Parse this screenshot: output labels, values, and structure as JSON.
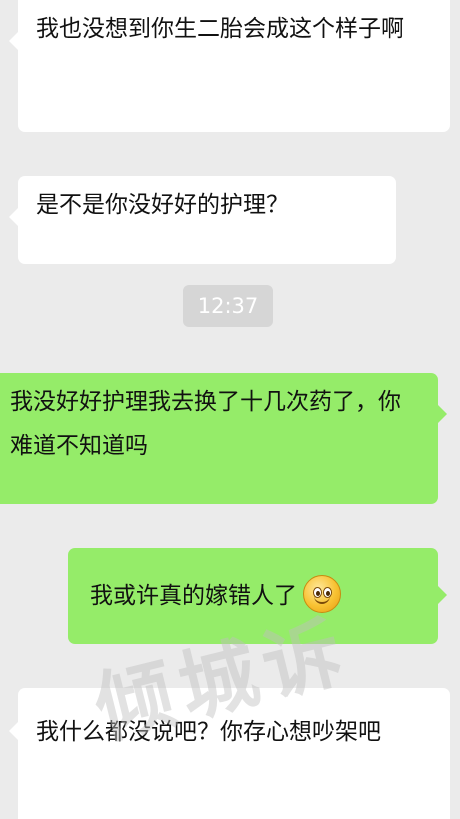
{
  "chat": {
    "timestamp": "12:37",
    "messages": [
      {
        "sender": "other",
        "text": "我也没想到你生二胎会成这个样子啊"
      },
      {
        "sender": "other",
        "text": "是不是你没好好的护理？"
      },
      {
        "sender": "self",
        "text": "我没好好护理我去换了十几次药了，你难道不知道吗"
      },
      {
        "sender": "self",
        "text": "我或许真的嫁错人了",
        "emoji": "smile-emoji-icon"
      },
      {
        "sender": "other",
        "text": "我什么都没说吧？你存心想吵架吧"
      }
    ]
  },
  "watermark": "倾城诉",
  "colors": {
    "background": "#ebebeb",
    "incoming_bubble": "#ffffff",
    "outgoing_bubble": "#95ec69",
    "timestamp_bg": "#d6d6d6"
  }
}
